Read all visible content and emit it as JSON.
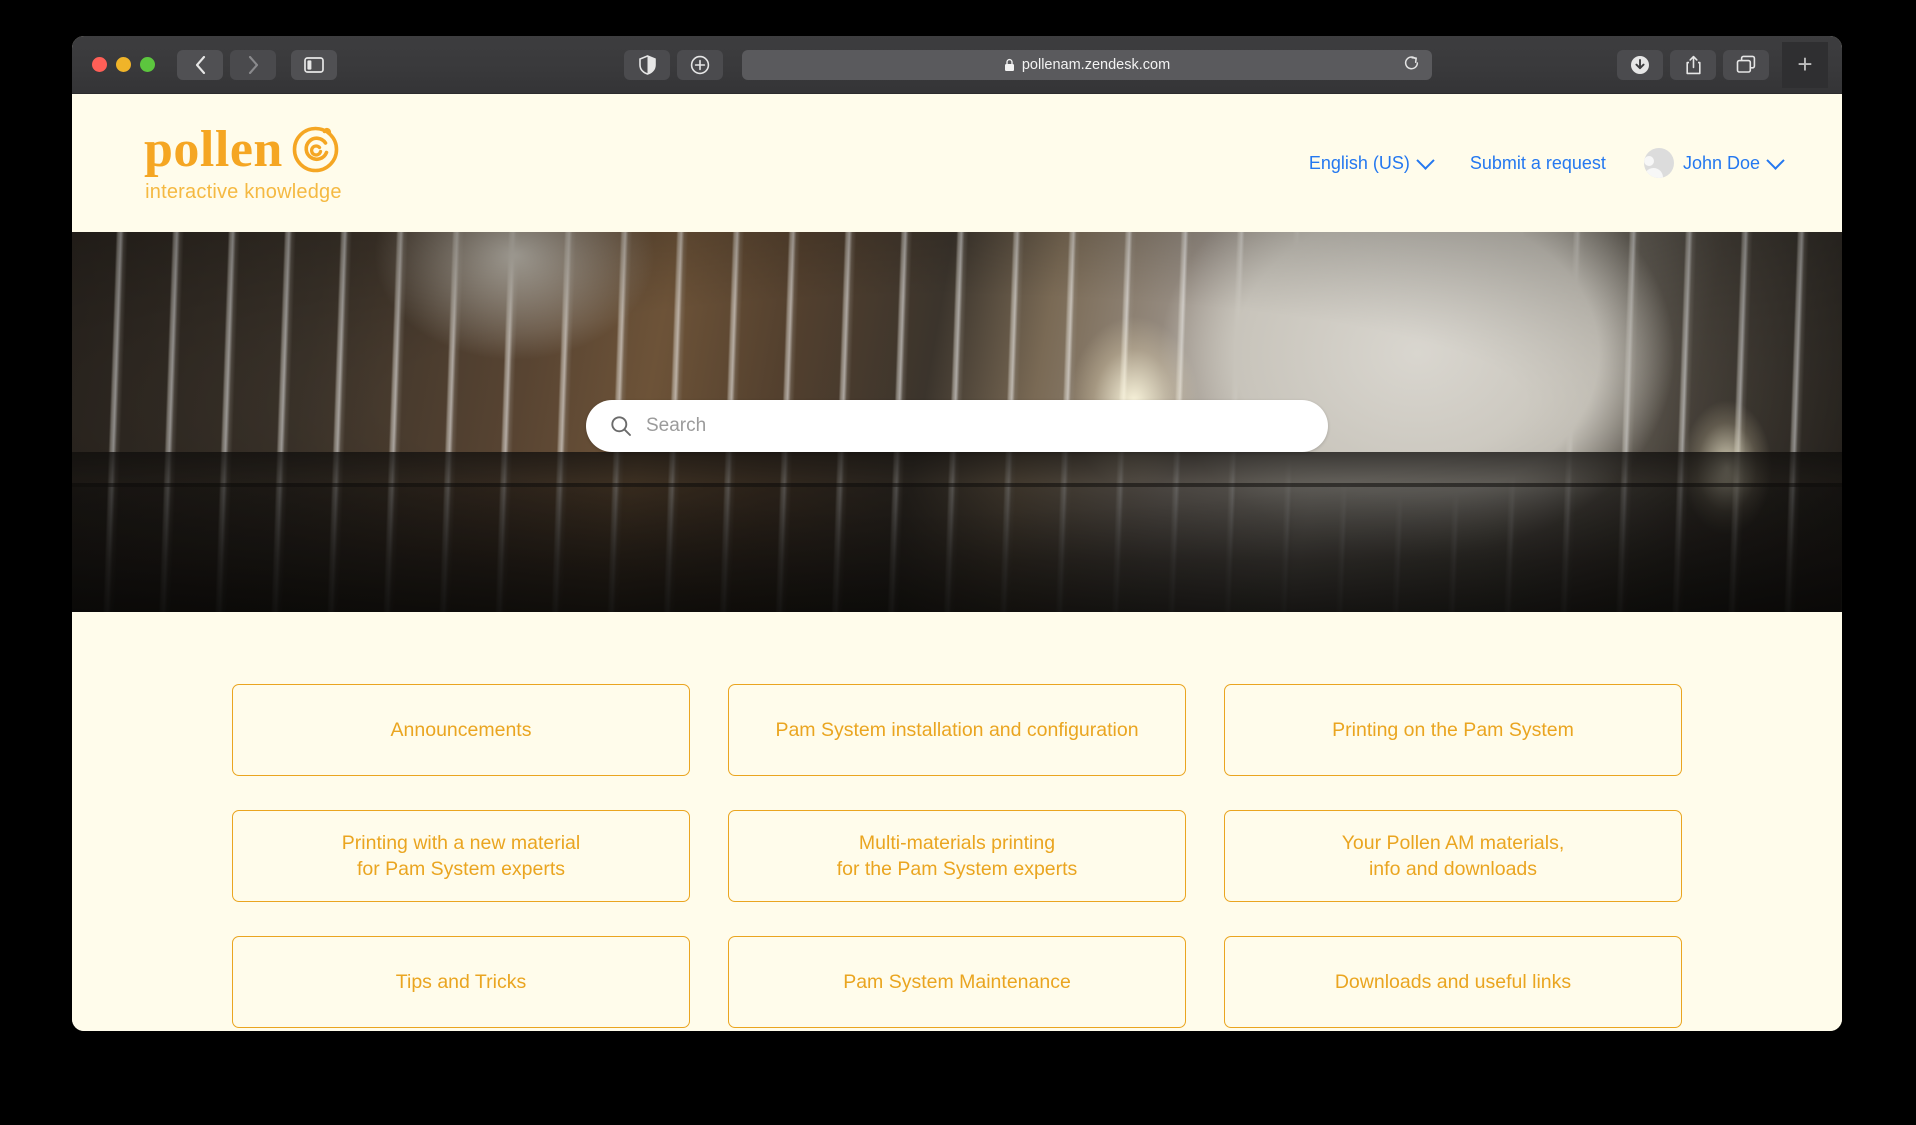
{
  "browser": {
    "back_icon": "back-chevron-icon",
    "forward_icon": "forward-chevron-icon",
    "sidebar_icon": "sidebar-toggle-icon",
    "shield_icon": "privacy-shield-icon",
    "zoom_icon": "zoom-in-icon",
    "lock_icon": "lock-icon",
    "url": "pollenam.zendesk.com",
    "reload_icon": "reload-icon",
    "download_icon": "downloads-icon",
    "share_icon": "share-icon",
    "tabs_icon": "tab-overview-icon",
    "new_tab_label": "+"
  },
  "header": {
    "logo": {
      "word": "pollen",
      "mark": "pollen-spiral-icon",
      "tagline": "interactive knowledge"
    },
    "nav": {
      "language": "English (US)",
      "submit_request": "Submit a request",
      "user": "John Doe",
      "avatar_icon": "user-avatar-icon",
      "chevron_icon": "chevron-down-icon"
    },
    "colors": {
      "link": "#2478f0",
      "brand": "#f5a623",
      "page_bg": "#FFFCEB"
    }
  },
  "hero": {
    "search": {
      "placeholder": "Search",
      "value": "",
      "icon": "search-icon"
    }
  },
  "categories": [
    {
      "line1": "Announcements",
      "line2": ""
    },
    {
      "line1": "Pam System installation and configuration",
      "line2": ""
    },
    {
      "line1": "Printing on the Pam System",
      "line2": ""
    },
    {
      "line1": "Printing with a new material",
      "line2": "for Pam System experts"
    },
    {
      "line1": "Multi-materials printing",
      "line2": "for the Pam System experts"
    },
    {
      "line1": "Your Pollen AM materials,",
      "line2": "info and downloads"
    },
    {
      "line1": "Tips and Tricks",
      "line2": ""
    },
    {
      "line1": "Pam System Maintenance",
      "line2": ""
    },
    {
      "line1": "Downloads and useful links",
      "line2": ""
    }
  ]
}
